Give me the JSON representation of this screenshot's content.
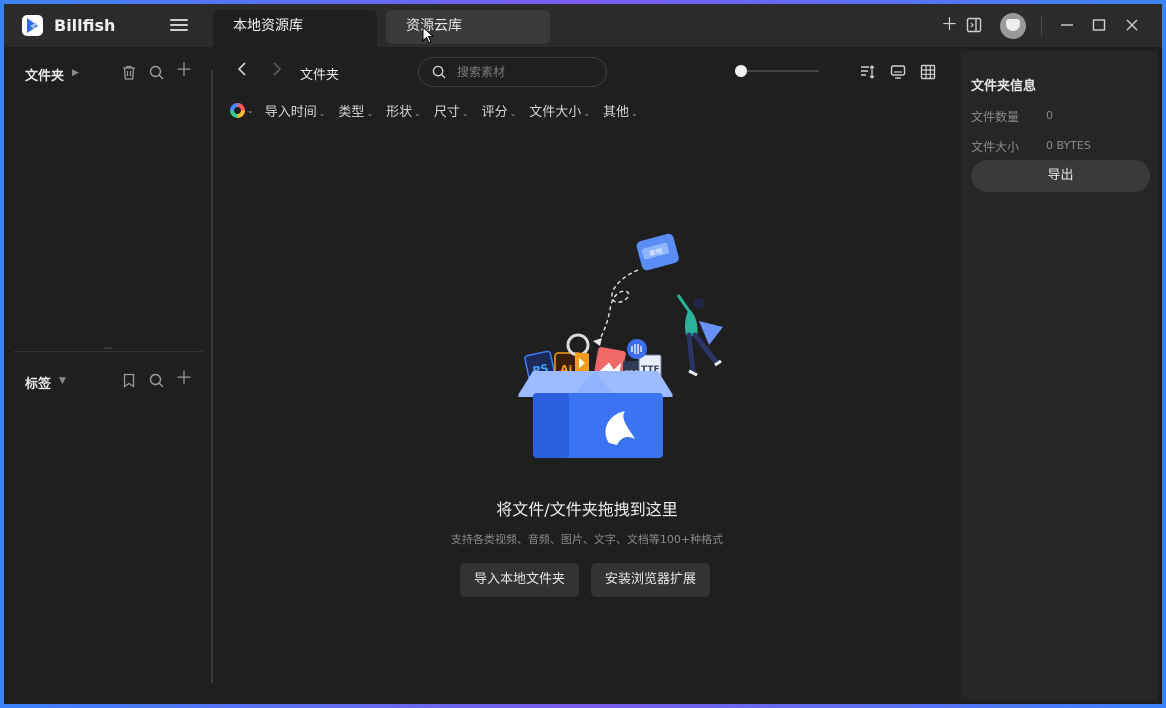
{
  "app": {
    "name": "Billfish"
  },
  "tabs": [
    {
      "label": "本地资源库",
      "active": true
    },
    {
      "label": "资源云库",
      "active": false
    }
  ],
  "sidebar": {
    "folders_title": "文件夹",
    "tags_title": "标签"
  },
  "toolbar": {
    "breadcrumb": "文件夹",
    "search_placeholder": "搜索素材",
    "zoom_fraction": 0.0
  },
  "filters": [
    "导入时间",
    "类型",
    "形状",
    "尺寸",
    "评分",
    "文件大小",
    "其他"
  ],
  "empty_state": {
    "title": "将文件/文件夹拖拽到这里",
    "subtitle": "支持各类视频、音频、图片、文字、文档等100+种格式",
    "import_button": "导入本地文件夹",
    "extension_button": "安装浏览器扩展",
    "badge_local": "本地",
    "file_types": [
      "PS",
      "Ai",
      "CDR",
      "TTF"
    ]
  },
  "info_panel": {
    "title": "文件夹信息",
    "count_label": "文件数量",
    "count_value": "0",
    "size_label": "文件大小",
    "size_value": "0 BYTES",
    "export_button": "导出"
  },
  "colors": {
    "accent": "#3b82f6",
    "bg": "#1f1f1f",
    "panel": "#262626",
    "titlebar": "#2b2b2b"
  }
}
